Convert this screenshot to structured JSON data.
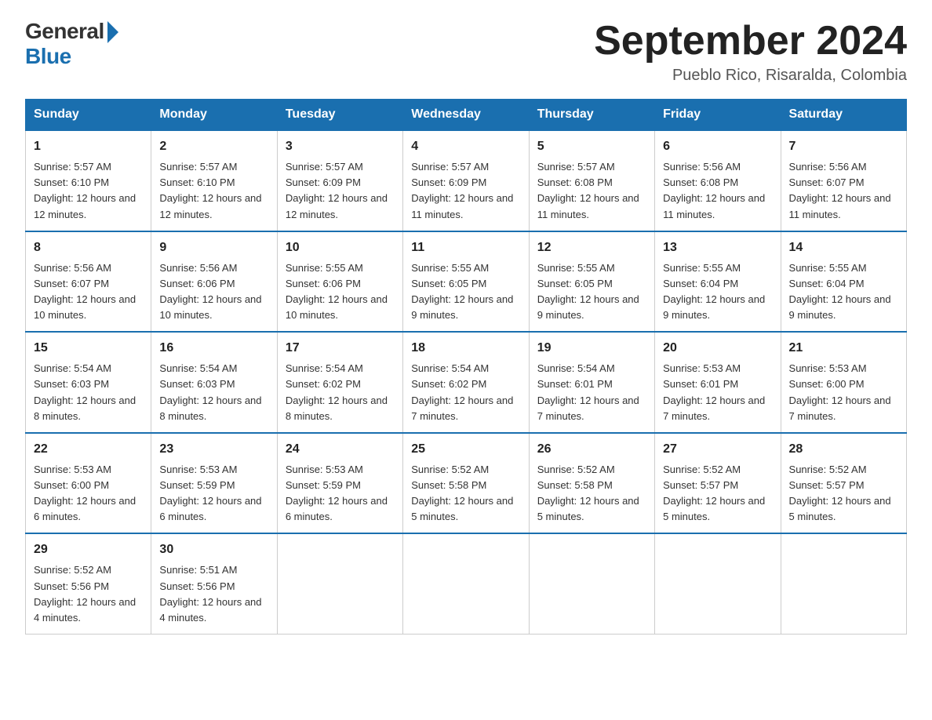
{
  "header": {
    "logo_general": "General",
    "logo_blue": "Blue",
    "month_title": "September 2024",
    "location": "Pueblo Rico, Risaralda, Colombia"
  },
  "weekdays": [
    "Sunday",
    "Monday",
    "Tuesday",
    "Wednesday",
    "Thursday",
    "Friday",
    "Saturday"
  ],
  "weeks": [
    [
      {
        "day": "1",
        "sunrise": "5:57 AM",
        "sunset": "6:10 PM",
        "daylight": "12 hours and 12 minutes."
      },
      {
        "day": "2",
        "sunrise": "5:57 AM",
        "sunset": "6:10 PM",
        "daylight": "12 hours and 12 minutes."
      },
      {
        "day": "3",
        "sunrise": "5:57 AM",
        "sunset": "6:09 PM",
        "daylight": "12 hours and 12 minutes."
      },
      {
        "day": "4",
        "sunrise": "5:57 AM",
        "sunset": "6:09 PM",
        "daylight": "12 hours and 11 minutes."
      },
      {
        "day": "5",
        "sunrise": "5:57 AM",
        "sunset": "6:08 PM",
        "daylight": "12 hours and 11 minutes."
      },
      {
        "day": "6",
        "sunrise": "5:56 AM",
        "sunset": "6:08 PM",
        "daylight": "12 hours and 11 minutes."
      },
      {
        "day": "7",
        "sunrise": "5:56 AM",
        "sunset": "6:07 PM",
        "daylight": "12 hours and 11 minutes."
      }
    ],
    [
      {
        "day": "8",
        "sunrise": "5:56 AM",
        "sunset": "6:07 PM",
        "daylight": "12 hours and 10 minutes."
      },
      {
        "day": "9",
        "sunrise": "5:56 AM",
        "sunset": "6:06 PM",
        "daylight": "12 hours and 10 minutes."
      },
      {
        "day": "10",
        "sunrise": "5:55 AM",
        "sunset": "6:06 PM",
        "daylight": "12 hours and 10 minutes."
      },
      {
        "day": "11",
        "sunrise": "5:55 AM",
        "sunset": "6:05 PM",
        "daylight": "12 hours and 9 minutes."
      },
      {
        "day": "12",
        "sunrise": "5:55 AM",
        "sunset": "6:05 PM",
        "daylight": "12 hours and 9 minutes."
      },
      {
        "day": "13",
        "sunrise": "5:55 AM",
        "sunset": "6:04 PM",
        "daylight": "12 hours and 9 minutes."
      },
      {
        "day": "14",
        "sunrise": "5:55 AM",
        "sunset": "6:04 PM",
        "daylight": "12 hours and 9 minutes."
      }
    ],
    [
      {
        "day": "15",
        "sunrise": "5:54 AM",
        "sunset": "6:03 PM",
        "daylight": "12 hours and 8 minutes."
      },
      {
        "day": "16",
        "sunrise": "5:54 AM",
        "sunset": "6:03 PM",
        "daylight": "12 hours and 8 minutes."
      },
      {
        "day": "17",
        "sunrise": "5:54 AM",
        "sunset": "6:02 PM",
        "daylight": "12 hours and 8 minutes."
      },
      {
        "day": "18",
        "sunrise": "5:54 AM",
        "sunset": "6:02 PM",
        "daylight": "12 hours and 7 minutes."
      },
      {
        "day": "19",
        "sunrise": "5:54 AM",
        "sunset": "6:01 PM",
        "daylight": "12 hours and 7 minutes."
      },
      {
        "day": "20",
        "sunrise": "5:53 AM",
        "sunset": "6:01 PM",
        "daylight": "12 hours and 7 minutes."
      },
      {
        "day": "21",
        "sunrise": "5:53 AM",
        "sunset": "6:00 PM",
        "daylight": "12 hours and 7 minutes."
      }
    ],
    [
      {
        "day": "22",
        "sunrise": "5:53 AM",
        "sunset": "6:00 PM",
        "daylight": "12 hours and 6 minutes."
      },
      {
        "day": "23",
        "sunrise": "5:53 AM",
        "sunset": "5:59 PM",
        "daylight": "12 hours and 6 minutes."
      },
      {
        "day": "24",
        "sunrise": "5:53 AM",
        "sunset": "5:59 PM",
        "daylight": "12 hours and 6 minutes."
      },
      {
        "day": "25",
        "sunrise": "5:52 AM",
        "sunset": "5:58 PM",
        "daylight": "12 hours and 5 minutes."
      },
      {
        "day": "26",
        "sunrise": "5:52 AM",
        "sunset": "5:58 PM",
        "daylight": "12 hours and 5 minutes."
      },
      {
        "day": "27",
        "sunrise": "5:52 AM",
        "sunset": "5:57 PM",
        "daylight": "12 hours and 5 minutes."
      },
      {
        "day": "28",
        "sunrise": "5:52 AM",
        "sunset": "5:57 PM",
        "daylight": "12 hours and 5 minutes."
      }
    ],
    [
      {
        "day": "29",
        "sunrise": "5:52 AM",
        "sunset": "5:56 PM",
        "daylight": "12 hours and 4 minutes."
      },
      {
        "day": "30",
        "sunrise": "5:51 AM",
        "sunset": "5:56 PM",
        "daylight": "12 hours and 4 minutes."
      },
      null,
      null,
      null,
      null,
      null
    ]
  ]
}
